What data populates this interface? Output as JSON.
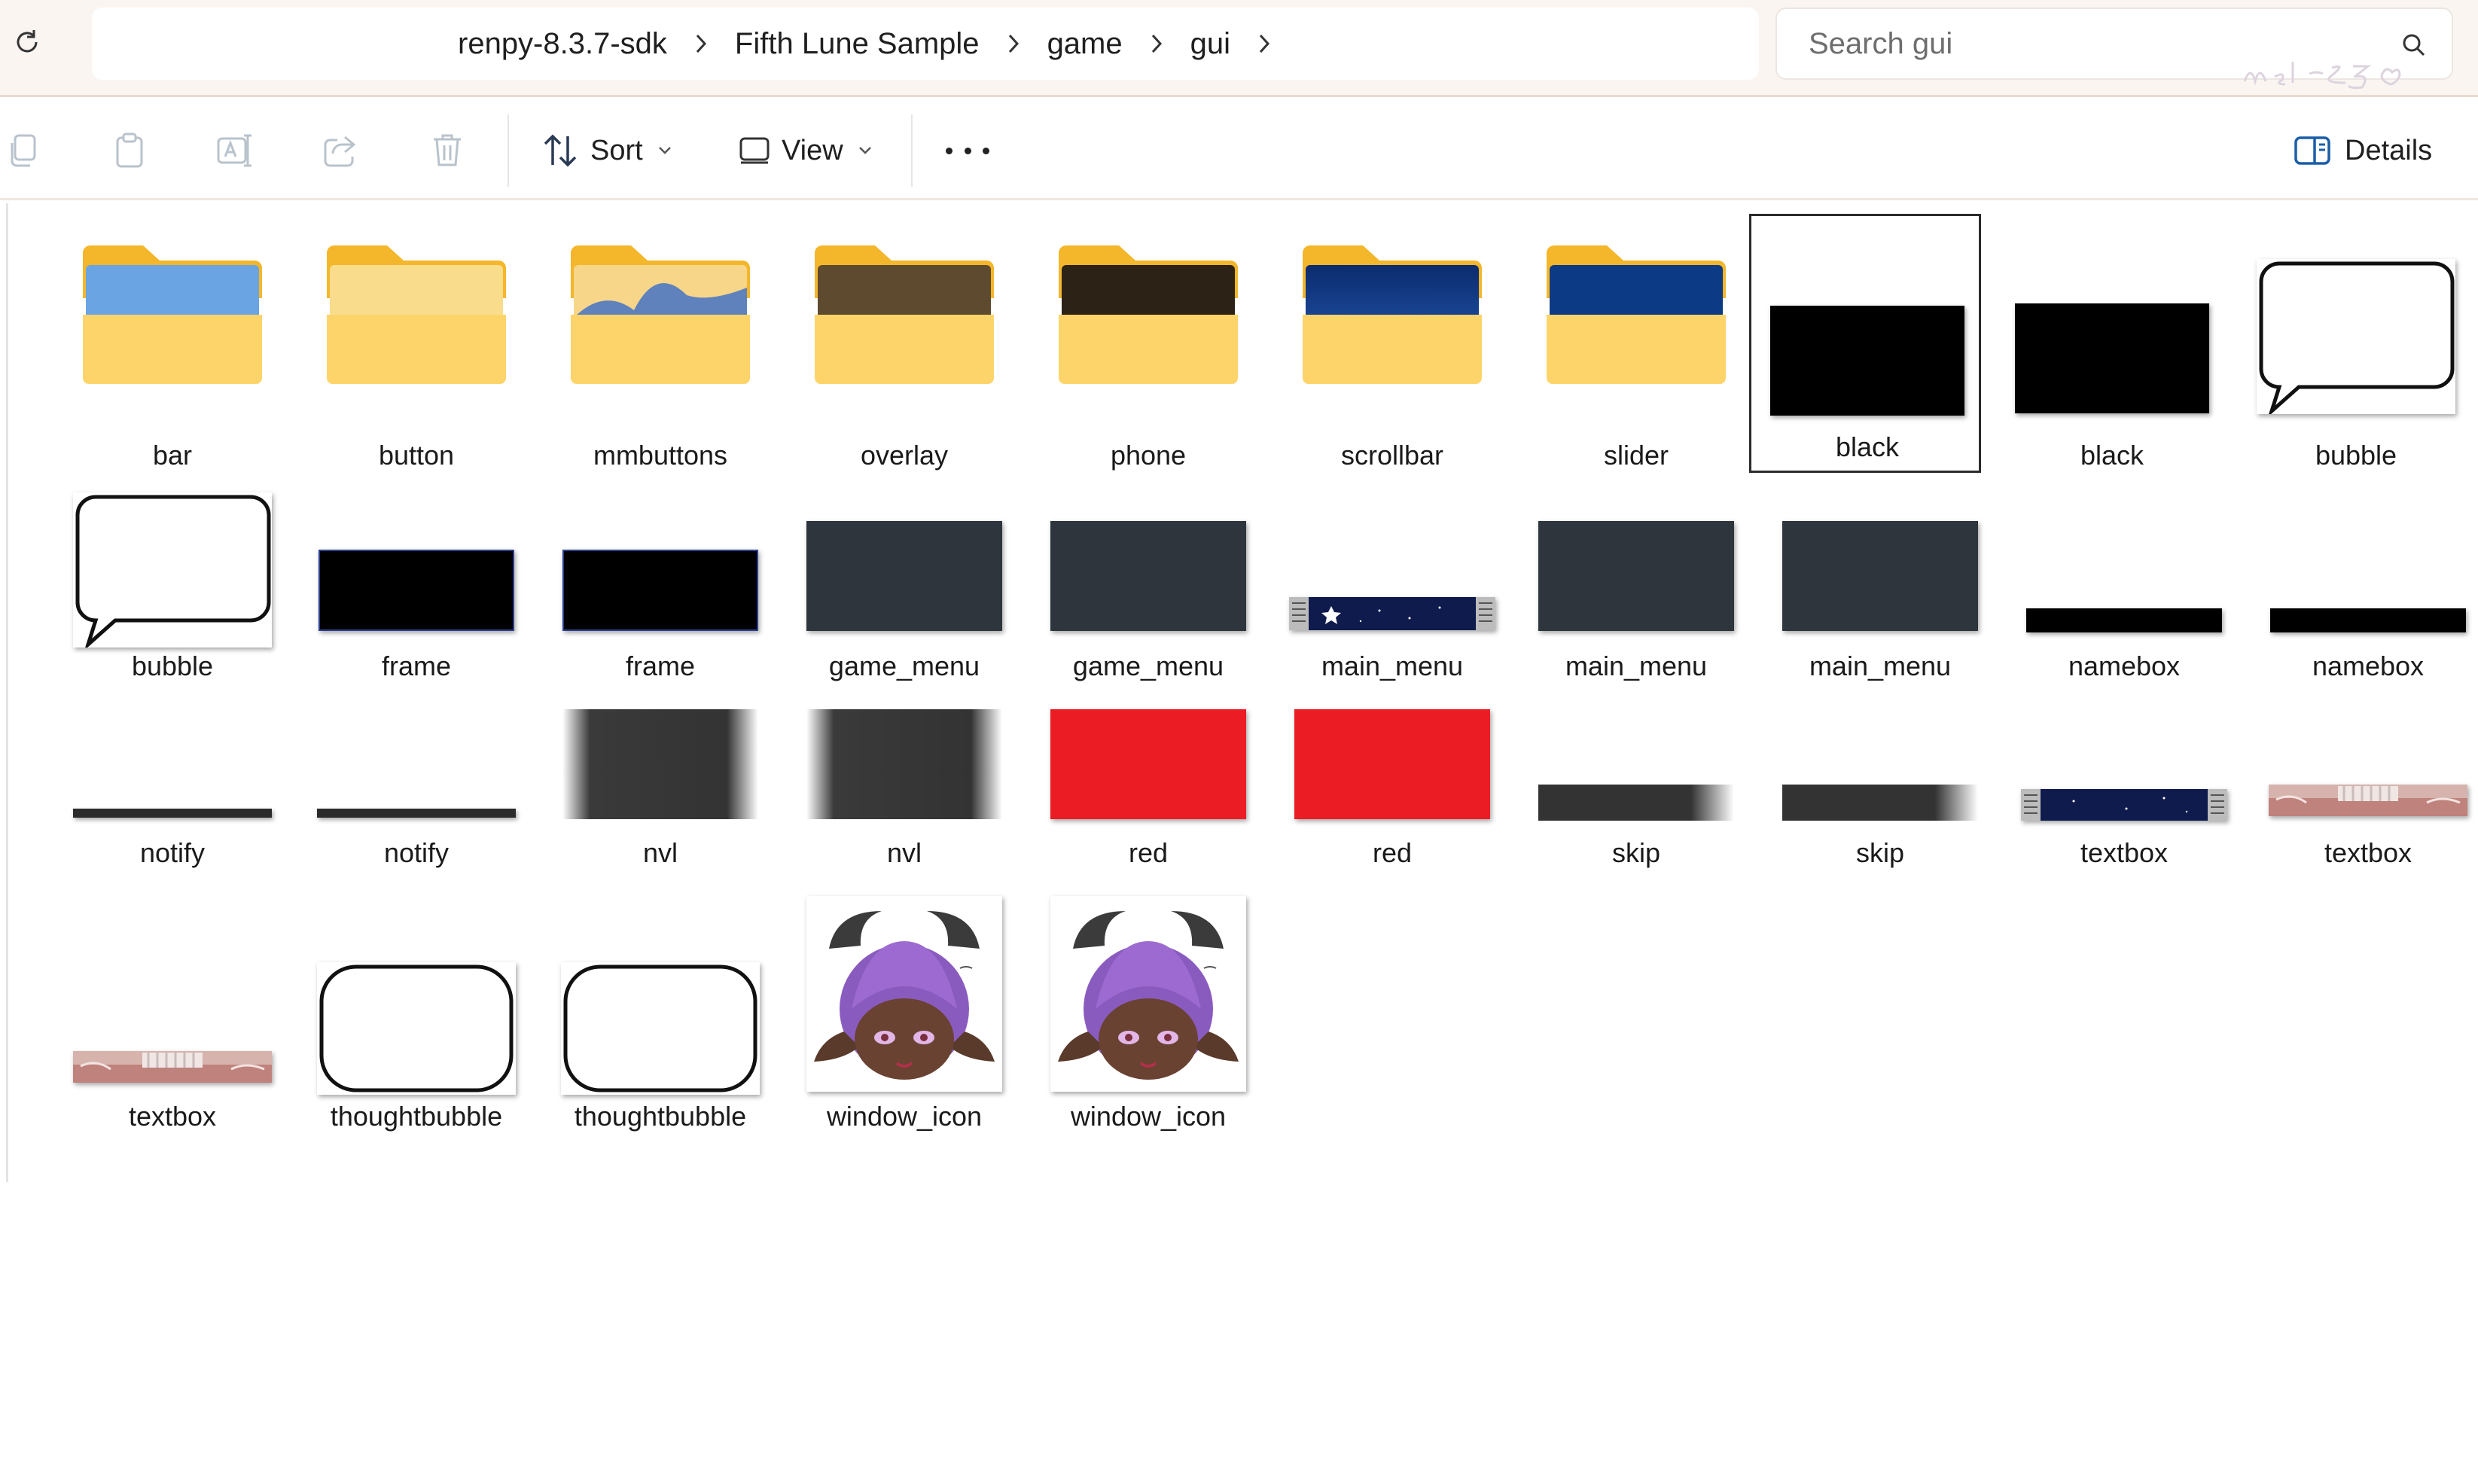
{
  "address_bar": {
    "refresh_icon": "refresh-icon",
    "breadcrumbs": [
      "renpy-8.3.7-sdk",
      "Fifth Lune Sample",
      "game",
      "gui"
    ],
    "search_placeholder": "Search gui"
  },
  "toolbar": {
    "sort_label": "Sort",
    "view_label": "View",
    "details_label": "Details",
    "icons": [
      "copy-icon",
      "paste-icon",
      "rename-icon",
      "share-icon",
      "delete-icon",
      "more-icon"
    ]
  },
  "items": [
    {
      "name": "bar",
      "kind": "folder",
      "thumb": "folder-blue"
    },
    {
      "name": "button",
      "kind": "folder",
      "thumb": "folder-plain"
    },
    {
      "name": "mmbuttons",
      "kind": "folder",
      "thumb": "folder-wave"
    },
    {
      "name": "overlay",
      "kind": "folder",
      "thumb": "folder-brown"
    },
    {
      "name": "phone",
      "kind": "folder",
      "thumb": "folder-dark"
    },
    {
      "name": "scrollbar",
      "kind": "folder",
      "thumb": "folder-navy-gradient"
    },
    {
      "name": "slider",
      "kind": "folder",
      "thumb": "folder-navy"
    },
    {
      "name": "black",
      "kind": "image",
      "selected": true
    },
    {
      "name": "black",
      "kind": "image"
    },
    {
      "name": "bubble",
      "kind": "image"
    },
    {
      "name": "bubble",
      "kind": "image"
    },
    {
      "name": "frame",
      "kind": "image"
    },
    {
      "name": "frame",
      "kind": "image"
    },
    {
      "name": "game_menu",
      "kind": "image"
    },
    {
      "name": "game_menu",
      "kind": "image"
    },
    {
      "name": "main_menu",
      "kind": "image"
    },
    {
      "name": "main_menu",
      "kind": "image"
    },
    {
      "name": "main_menu",
      "kind": "image"
    },
    {
      "name": "namebox",
      "kind": "image"
    },
    {
      "name": "namebox",
      "kind": "image"
    },
    {
      "name": "notify",
      "kind": "image"
    },
    {
      "name": "notify",
      "kind": "image"
    },
    {
      "name": "nvl",
      "kind": "image"
    },
    {
      "name": "nvl",
      "kind": "image"
    },
    {
      "name": "red",
      "kind": "image"
    },
    {
      "name": "red",
      "kind": "image"
    },
    {
      "name": "skip",
      "kind": "image"
    },
    {
      "name": "skip",
      "kind": "image"
    },
    {
      "name": "textbox",
      "kind": "image"
    },
    {
      "name": "textbox",
      "kind": "image"
    },
    {
      "name": "textbox",
      "kind": "image"
    },
    {
      "name": "thoughtbubble",
      "kind": "image"
    },
    {
      "name": "thoughtbubble",
      "kind": "image"
    },
    {
      "name": "window_icon",
      "kind": "image"
    },
    {
      "name": "window_icon",
      "kind": "image"
    }
  ],
  "colors": {
    "folder_yellow": "#f8c93c",
    "folder_front": "#fdd971",
    "red_swatch": "#ec1c24",
    "slate": "#2e353d",
    "navy": "#10205a"
  },
  "signature": "mel~25"
}
